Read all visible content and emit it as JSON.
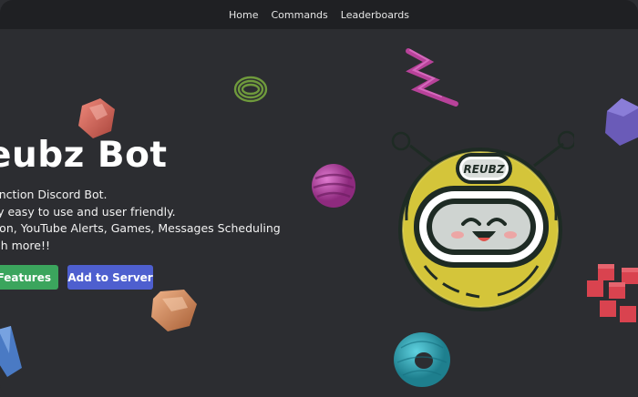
{
  "nav": {
    "items": [
      "Home",
      "Commands",
      "Leaderboards"
    ]
  },
  "hero": {
    "title": "eubz Bot",
    "description_lines": [
      "tifunction Discord Bot.",
      "nely easy to use and user friendly.",
      "ration, YouTube Alerts, Games, Messages Scheduling",
      "nuch more!!"
    ],
    "buttons": {
      "features": "v Features",
      "add": "Add to Server"
    }
  },
  "mascot": {
    "label": "REUBZ"
  },
  "colors": {
    "background": "#2c2d31",
    "navbar": "#1f2023",
    "features_button": "#3ba55d",
    "add_button": "#4e5fcf",
    "mascot_yellow": "#d4c53a"
  },
  "decorations": [
    "gem-icon",
    "spring-icon",
    "sphere-icon",
    "cube-icon",
    "torus-icon",
    "crystal-icon"
  ]
}
